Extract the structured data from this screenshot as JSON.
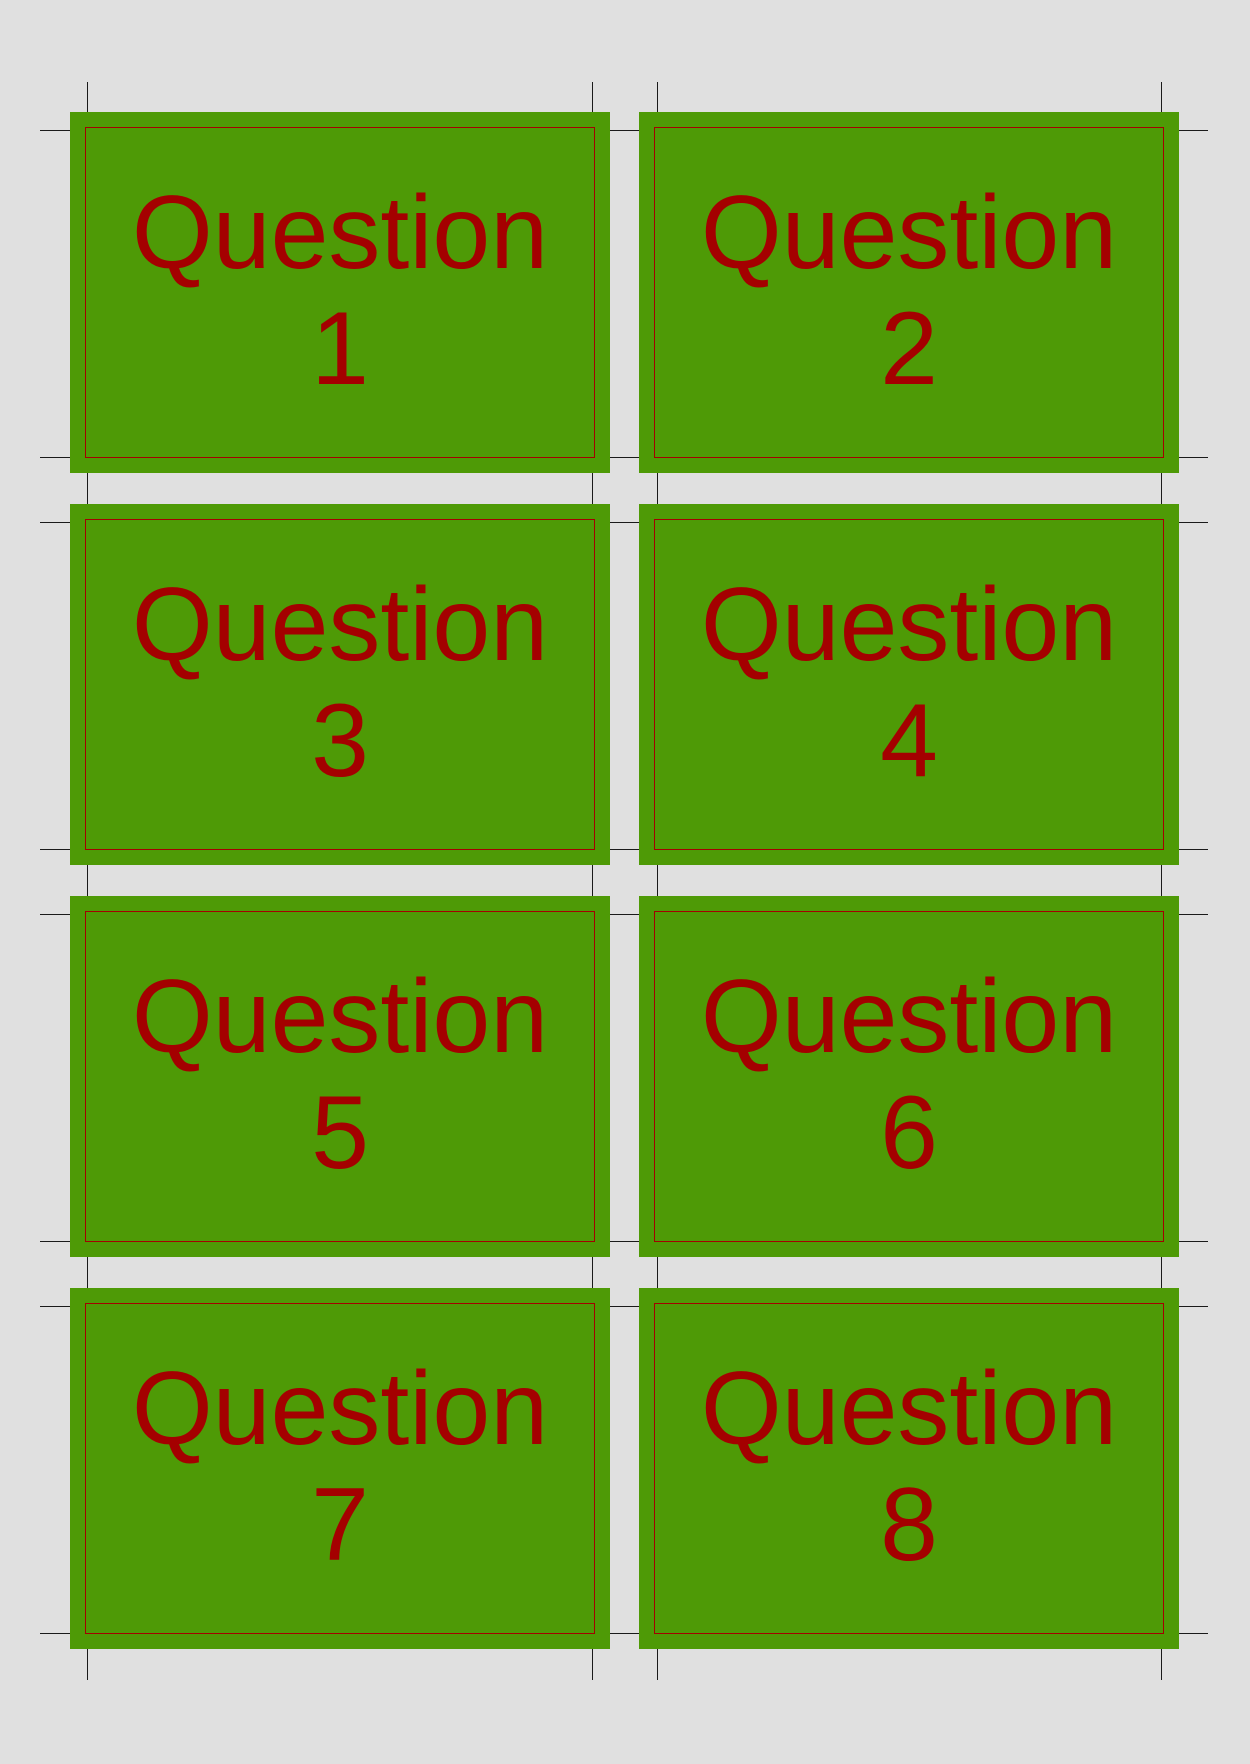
{
  "colors": {
    "page_background": "#e0e0e0",
    "card_fill": "#4e9a06",
    "card_border": "#a40000",
    "card_text": "#a40000",
    "crop_marks": "#1a1a1a"
  },
  "cards": [
    {
      "word": "Question",
      "number": "1"
    },
    {
      "word": "Question",
      "number": "2"
    },
    {
      "word": "Question",
      "number": "3"
    },
    {
      "word": "Question",
      "number": "4"
    },
    {
      "word": "Question",
      "number": "5"
    },
    {
      "word": "Question",
      "number": "6"
    },
    {
      "word": "Question",
      "number": "7"
    },
    {
      "word": "Question",
      "number": "8"
    }
  ]
}
